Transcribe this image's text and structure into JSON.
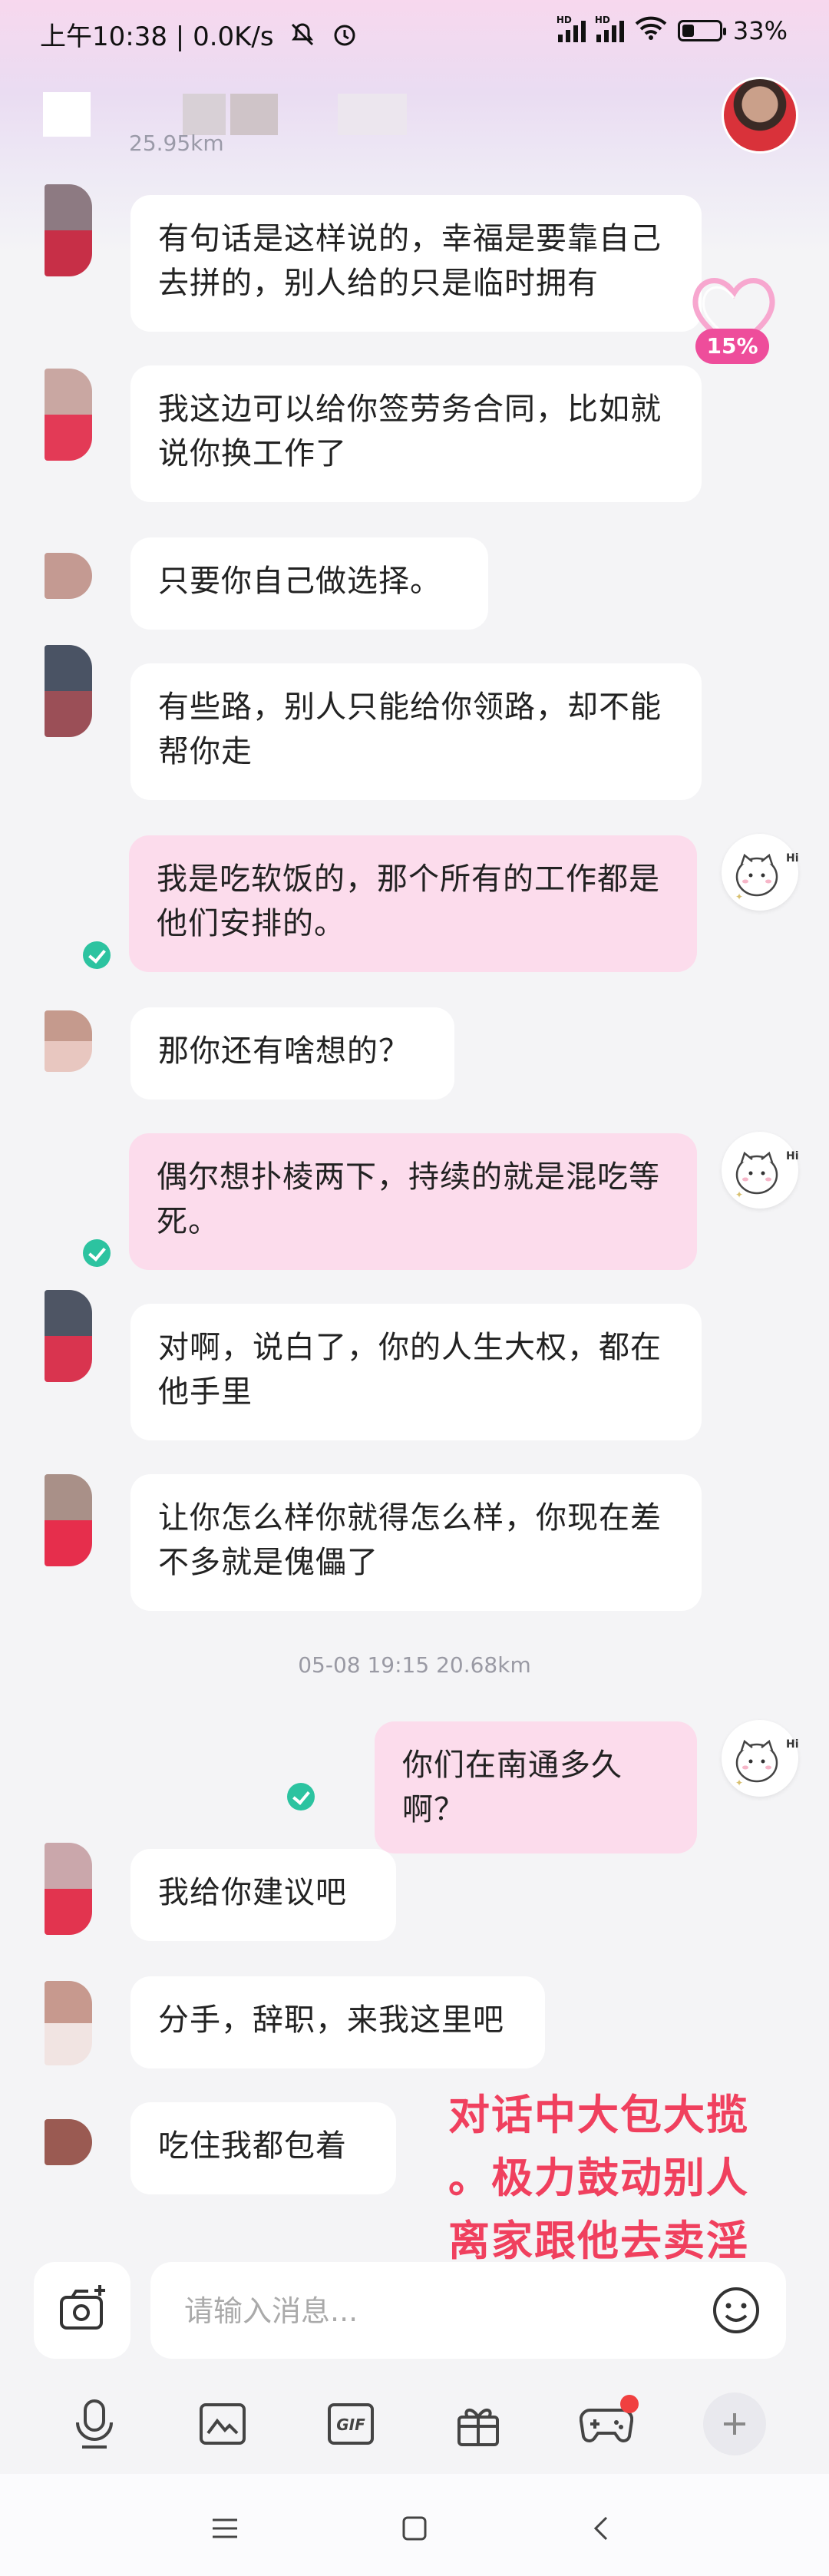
{
  "status_bar": {
    "time": "上午10:38",
    "network_speed": "0.0K/s",
    "battery": "33%",
    "battery_level": 0.33
  },
  "header": {
    "subtitle": "25.95km"
  },
  "gift_widget": {
    "percent": "15%"
  },
  "messages": [
    {
      "dir": "in",
      "text": "有句话是这样说的，幸福是要靠自己去拼的，别人给的只是临时拥有",
      "avatar": [
        "#8d7a82",
        "#c72f47"
      ]
    },
    {
      "dir": "in",
      "text": "我这边可以给你签劳务合同，比如就说你换工作了",
      "avatar": [
        "#c9a7a2",
        "#e33a56"
      ]
    },
    {
      "dir": "in",
      "text": "只要你自己做选择。",
      "avatar": [
        "#c49a92",
        "#c49a92"
      ]
    },
    {
      "dir": "in",
      "text": "有些路，别人只能给你领路，却不能帮你走",
      "avatar": [
        "#4a5364",
        "#9b4f57"
      ]
    },
    {
      "dir": "out",
      "text": "我是吃软饭的，那个所有的工作都是他们安排的。"
    },
    {
      "dir": "in",
      "text": "那你还有啥想的？",
      "avatar": [
        "#c59a8d",
        "#e8c7c0"
      ]
    },
    {
      "dir": "out",
      "text": "偶尔想扑棱两下，持续的就是混吃等死。"
    },
    {
      "dir": "in",
      "text": "对啊，说白了，你的人生大权，都在他手里",
      "avatar": [
        "#4e5564",
        "#d9344f"
      ]
    },
    {
      "dir": "in",
      "text": "让你怎么样你就得怎么样，你现在差不多就是傀儡了",
      "avatar": [
        "#a99088",
        "#e62e4c"
      ]
    },
    {
      "dir": "out",
      "text": "你们在南通多久啊？"
    },
    {
      "dir": "in",
      "text": "我给你建议吧",
      "avatar": [
        "#caa7ab",
        "#e2344f"
      ]
    },
    {
      "dir": "in",
      "text": "分手，辞职，来我这里吧",
      "avatar": [
        "#c7998e",
        "#f1e4e2"
      ]
    },
    {
      "dir": "in",
      "text": "吃住我都包着",
      "avatar": [
        "#9a5a52",
        "#9a5a52"
      ]
    }
  ],
  "timestamp": "05-08 19:15  20.68km",
  "overlay_text": [
    "对话中大包大揽",
    "。极力鼓动别人",
    "离家跟他去卖淫"
  ],
  "input": {
    "placeholder": "请输入消息..."
  },
  "colors": {
    "accent_pink": "#ee4d9b",
    "outgoing_bubble": "#fcdcec",
    "incoming_bubble": "#ffffff",
    "read_check": "#2cc3a0",
    "overlay_red": "#f0405e"
  },
  "toolbar_icons": [
    "voice-icon",
    "image-icon",
    "gif-icon",
    "gift-icon",
    "game-icon",
    "plus-icon"
  ],
  "nav_icons": [
    "menu-icon",
    "home-icon",
    "back-icon"
  ]
}
